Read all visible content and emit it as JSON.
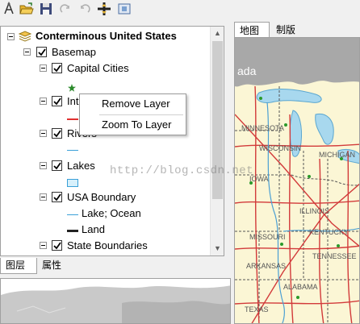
{
  "toolbar": {
    "buttons": [
      "identify-icon",
      "open-icon",
      "save-icon",
      "redo-icon",
      "undo-icon",
      "add-data-icon",
      "full-extent-icon"
    ]
  },
  "toc": {
    "root": "Conterminous United States",
    "group": "Basemap",
    "layers": [
      {
        "label": "Capital Cities"
      },
      {
        "label": "Interstates",
        "visible_text": "Int"
      },
      {
        "label": "Rivers",
        "visible_text": "Rivers"
      },
      {
        "label": "Lakes"
      },
      {
        "label": "USA Boundary"
      },
      {
        "label": "State Boundaries"
      }
    ],
    "legend": {
      "lake_ocean": "Lake; Ocean",
      "land": "Land"
    }
  },
  "context_menu": {
    "items": [
      "Remove Layer",
      "Zoom To Layer"
    ]
  },
  "left_tabs": [
    "图层",
    "属性"
  ],
  "right_tabs": [
    "地图",
    "制版"
  ],
  "map": {
    "region_labels": [
      "ada",
      "MINNESOTA",
      "WISCONSIN",
      "MICHIGAN",
      "IOWA",
      "ILLINOIS",
      "MISSOURI",
      "KENTUCKY",
      "ARKANSAS",
      "TENNESSEE",
      "ALABAMA",
      "TEXAS"
    ]
  },
  "watermark": "http://blog.csdn.net"
}
